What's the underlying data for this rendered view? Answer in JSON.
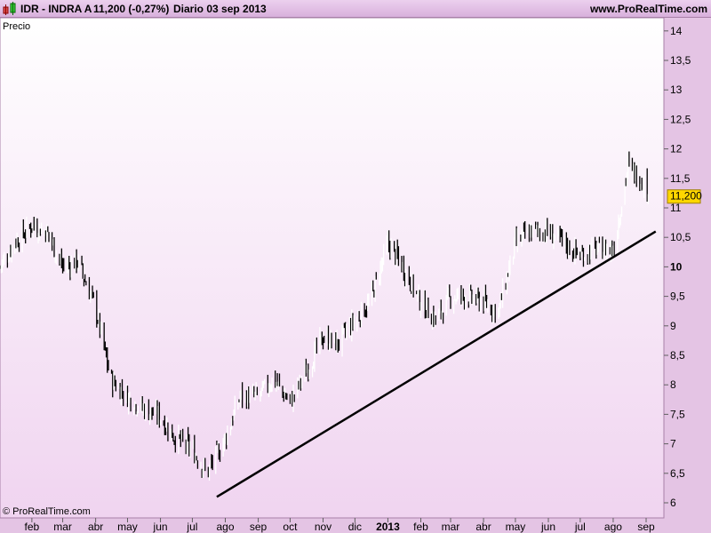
{
  "header": {
    "symbol": "IDR - INDRA A",
    "last": "11,200 (-0,27%)",
    "period": "Diario  03 sep 2013",
    "site": "www.ProRealTime.com"
  },
  "panel_label": "Precio",
  "copyright": "© ProRealTime.com",
  "colors": {
    "up": "#ffffff",
    "down": "#000000",
    "price_tag": "#ffd700",
    "trendline": "#000000"
  },
  "chart_data": {
    "type": "candlestick",
    "ylim": [
      5.8,
      14.2
    ],
    "yticks": [
      6,
      6.5,
      7,
      7.5,
      8,
      8.5,
      9,
      9.5,
      10,
      10.5,
      11,
      11.5,
      12,
      12.5,
      13,
      13.5,
      14
    ],
    "ytick_labels": [
      "6",
      "6,5",
      "7",
      "7,5",
      "8",
      "8,5",
      "9",
      "9,5",
      "10",
      "10,5",
      "11",
      "11,5",
      "12",
      "12,5",
      "13",
      "13,5",
      "14"
    ],
    "xticks": [
      {
        "date": "2012-02-01",
        "label": "feb"
      },
      {
        "date": "2012-03-01",
        "label": "mar"
      },
      {
        "date": "2012-04-01",
        "label": "abr"
      },
      {
        "date": "2012-05-01",
        "label": "may"
      },
      {
        "date": "2012-06-01",
        "label": "jun"
      },
      {
        "date": "2012-07-01",
        "label": "jul"
      },
      {
        "date": "2012-08-01",
        "label": "ago"
      },
      {
        "date": "2012-09-01",
        "label": "sep"
      },
      {
        "date": "2012-10-01",
        "label": "oct"
      },
      {
        "date": "2012-11-01",
        "label": "nov"
      },
      {
        "date": "2012-12-01",
        "label": "dic"
      },
      {
        "date": "2013-01-01",
        "label": "2013"
      },
      {
        "date": "2013-02-01",
        "label": "feb"
      },
      {
        "date": "2013-03-01",
        "label": "mar"
      },
      {
        "date": "2013-04-01",
        "label": "abr"
      },
      {
        "date": "2013-05-01",
        "label": "may"
      },
      {
        "date": "2013-06-01",
        "label": "jun"
      },
      {
        "date": "2013-07-01",
        "label": "jul"
      },
      {
        "date": "2013-08-01",
        "label": "ago"
      },
      {
        "date": "2013-09-01",
        "label": "sep"
      }
    ],
    "closes": [
      [
        "2012-01-02",
        10.0
      ],
      [
        "2012-01-15",
        10.4
      ],
      [
        "2012-02-01",
        10.7
      ],
      [
        "2012-02-15",
        10.6
      ],
      [
        "2012-03-01",
        10.0
      ],
      [
        "2012-03-15",
        10.1
      ],
      [
        "2012-04-01",
        9.3
      ],
      [
        "2012-04-15",
        8.1
      ],
      [
        "2012-05-01",
        7.8
      ],
      [
        "2012-05-15",
        7.6
      ],
      [
        "2012-06-01",
        7.45
      ],
      [
        "2012-06-15",
        7.1
      ],
      [
        "2012-07-01",
        6.9
      ],
      [
        "2012-07-15",
        6.5
      ],
      [
        "2012-08-01",
        7.1
      ],
      [
        "2012-08-15",
        7.8
      ],
      [
        "2012-09-01",
        7.8
      ],
      [
        "2012-09-15",
        8.1
      ],
      [
        "2012-10-01",
        7.7
      ],
      [
        "2012-10-15",
        8.2
      ],
      [
        "2012-11-01",
        8.8
      ],
      [
        "2012-11-15",
        8.7
      ],
      [
        "2012-12-01",
        9.1
      ],
      [
        "2012-12-15",
        9.4
      ],
      [
        "2013-01-01",
        10.4
      ],
      [
        "2013-01-15",
        10.0
      ],
      [
        "2013-02-01",
        9.4
      ],
      [
        "2013-02-15",
        9.1
      ],
      [
        "2013-03-01",
        9.5
      ],
      [
        "2013-03-15",
        9.5
      ],
      [
        "2013-04-01",
        9.4
      ],
      [
        "2013-04-15",
        9.25
      ],
      [
        "2013-05-01",
        10.4
      ],
      [
        "2013-05-15",
        10.6
      ],
      [
        "2013-06-01",
        10.6
      ],
      [
        "2013-06-15",
        10.4
      ],
      [
        "2013-07-01",
        10.2
      ],
      [
        "2013-07-15",
        10.3
      ],
      [
        "2013-08-01",
        10.3
      ],
      [
        "2013-08-15",
        11.7
      ],
      [
        "2013-09-01",
        11.4
      ],
      [
        "2013-09-03",
        11.2
      ]
    ],
    "last_price_label": "11,200",
    "trendline": {
      "start": [
        "2012-07-24",
        6.1
      ],
      "end": [
        "2013-09-10",
        10.6
      ]
    },
    "grid": false
  }
}
